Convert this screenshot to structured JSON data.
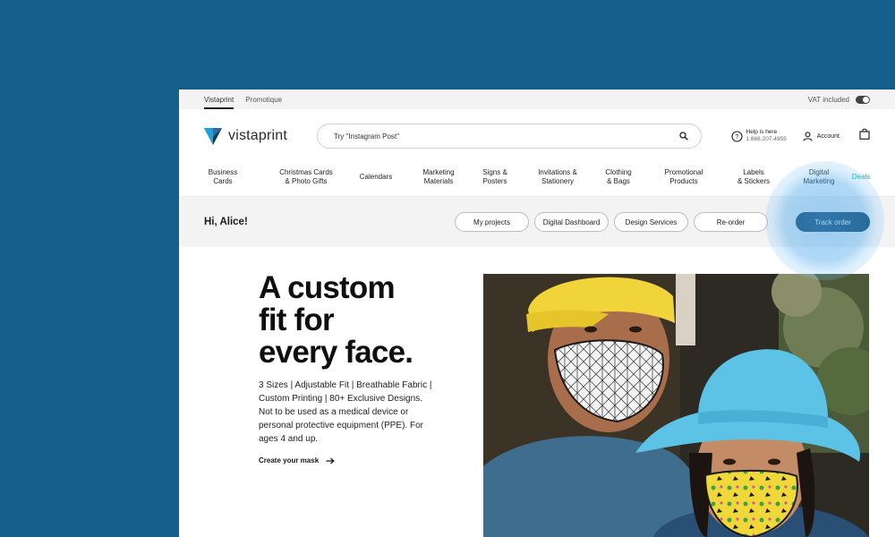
{
  "utilbar": {
    "brands": [
      "Vistaprint",
      "Promotique"
    ],
    "vat_label": "VAT included"
  },
  "header": {
    "logo_text": "vistaprint",
    "search_placeholder": "Try \"Instagram Post\"",
    "help_line1": "Help is here",
    "help_line2": "1.866.207.4955",
    "account_label": "Account"
  },
  "nav": {
    "items": [
      {
        "label": "Business\nCards"
      },
      {
        "label": "Christmas Cards\n& Photo Gifts"
      },
      {
        "label": "Calendars"
      },
      {
        "label": "Marketing\nMaterials"
      },
      {
        "label": "Signs &\nPosters"
      },
      {
        "label": "Invitations &\nStationery"
      },
      {
        "label": "Clothing\n& Bags"
      },
      {
        "label": "Promotional\nProducts"
      },
      {
        "label": "Labels\n& Stickers"
      },
      {
        "label": "Digital\nMarketing"
      },
      {
        "label": "Deals"
      }
    ]
  },
  "greeting": {
    "text": "Hi, Alice!",
    "buttons": [
      "My projects",
      "Digital Dashboard",
      "Design Services",
      "Re-order",
      "Track order"
    ]
  },
  "hero": {
    "headline": [
      "A custom",
      "fit for",
      "every face."
    ],
    "description": "3 Sizes | Adjustable Fit | Breathable Fabric | Custom Printing | 80+ Exclusive Designs. Not to be used as a medical device or personal protective equipment (PPE). For ages 4 and up.",
    "cta": "Create your mask"
  },
  "colors": {
    "page_background": "#155f8d",
    "primary_button": "#0a3a5c",
    "deals": "#13a6a6",
    "highlight": "#50aaeb"
  }
}
